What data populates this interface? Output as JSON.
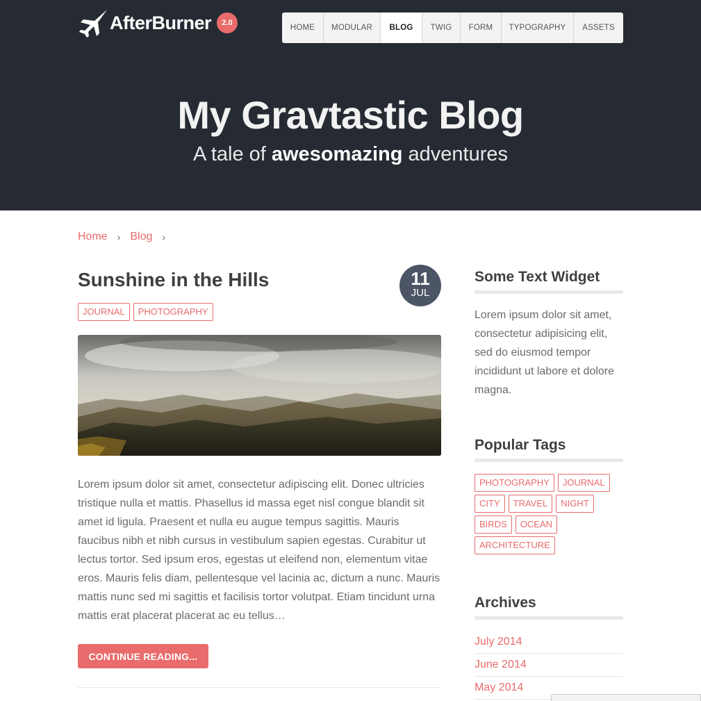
{
  "header": {
    "logo_text": "AfterBurner",
    "logo_badge": "2.0",
    "nav": [
      {
        "label": "HOME"
      },
      {
        "label": "MODULAR"
      },
      {
        "label": "BLOG",
        "active": true
      },
      {
        "label": "TWIG"
      },
      {
        "label": "FORM"
      },
      {
        "label": "TYPOGRAPHY"
      },
      {
        "label": "ASSETS"
      }
    ]
  },
  "hero": {
    "title": "My Gravtastic Blog",
    "subtitle_pre": "A tale of ",
    "subtitle_bold": "awesomazing",
    "subtitle_post": " adventures"
  },
  "breadcrumb": [
    {
      "label": "Home"
    },
    {
      "label": "Blog"
    }
  ],
  "post": {
    "title": "Sunshine in the Hills",
    "date_day": "11",
    "date_month": "JUL",
    "tags": [
      "JOURNAL",
      "PHOTOGRAPHY"
    ],
    "excerpt": "Lorem ipsum dolor sit amet, consectetur adipiscing elit. Donec ultricies tristique nulla et mattis. Phasellus id massa eget nisl congue blandit sit amet id ligula. Praesent et nulla eu augue tempus sagittis. Mauris faucibus nibh et nibh cursus in vestibulum sapien egestas. Curabitur ut lectus tortor. Sed ipsum eros, egestas ut eleifend non, elementum vitae eros. Mauris felis diam, pellentesque vel lacinia ac, dictum a nunc. Mauris mattis nunc sed mi sagittis et facilisis tortor volutpat. Etiam tincidunt urna mattis erat placerat placerat ac eu tellus…",
    "continue_label": "CONTINUE READING..."
  },
  "sidebar": {
    "text_widget": {
      "title": "Some Text Widget",
      "body": "Lorem ipsum dolor sit amet, consectetur adipisicing elit, sed do eiusmod tempor incididunt ut labore et dolore magna."
    },
    "tags_widget": {
      "title": "Popular Tags",
      "tags": [
        "PHOTOGRAPHY",
        "JOURNAL",
        "CITY",
        "TRAVEL",
        "NIGHT",
        "BIRDS",
        "OCEAN",
        "ARCHITECTURE"
      ]
    },
    "archives_widget": {
      "title": "Archives",
      "items": [
        "July 2014",
        "June 2014",
        "May 2014"
      ]
    }
  },
  "colors": {
    "header_bg": "#262b33",
    "accent": "#e96b6b",
    "date_badge": "#4b5566"
  }
}
